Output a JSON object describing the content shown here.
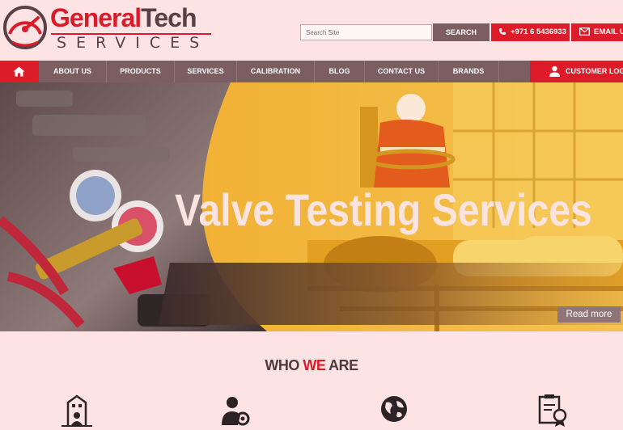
{
  "brand": {
    "name_part1": "General",
    "name_part2": "Tech",
    "subtitle": "SERVICES",
    "accent": "#dd1c2a",
    "dark": "#5b3f46"
  },
  "topbar": {
    "search_placeholder": "Search Site",
    "search_button": "SEARCH",
    "phone": "+971 6 5436933",
    "email_label": "EMAIL US"
  },
  "nav": {
    "home_icon": "home-icon",
    "items": [
      "ABOUT US",
      "PRODUCTS",
      "SERVICES",
      "CALIBRATION",
      "BLOG",
      "CONTACT US",
      "BRANDS"
    ],
    "login": "CUSTOMER LOGIN"
  },
  "hero": {
    "headline": "Valve Testing Services",
    "cta": "Read more"
  },
  "about": {
    "title_part1": "WHO ",
    "title_part2": "WE",
    "title_part3": " ARE",
    "icons": [
      "building-icon",
      "user-settings-icon",
      "globe-icon",
      "certificate-icon"
    ]
  }
}
